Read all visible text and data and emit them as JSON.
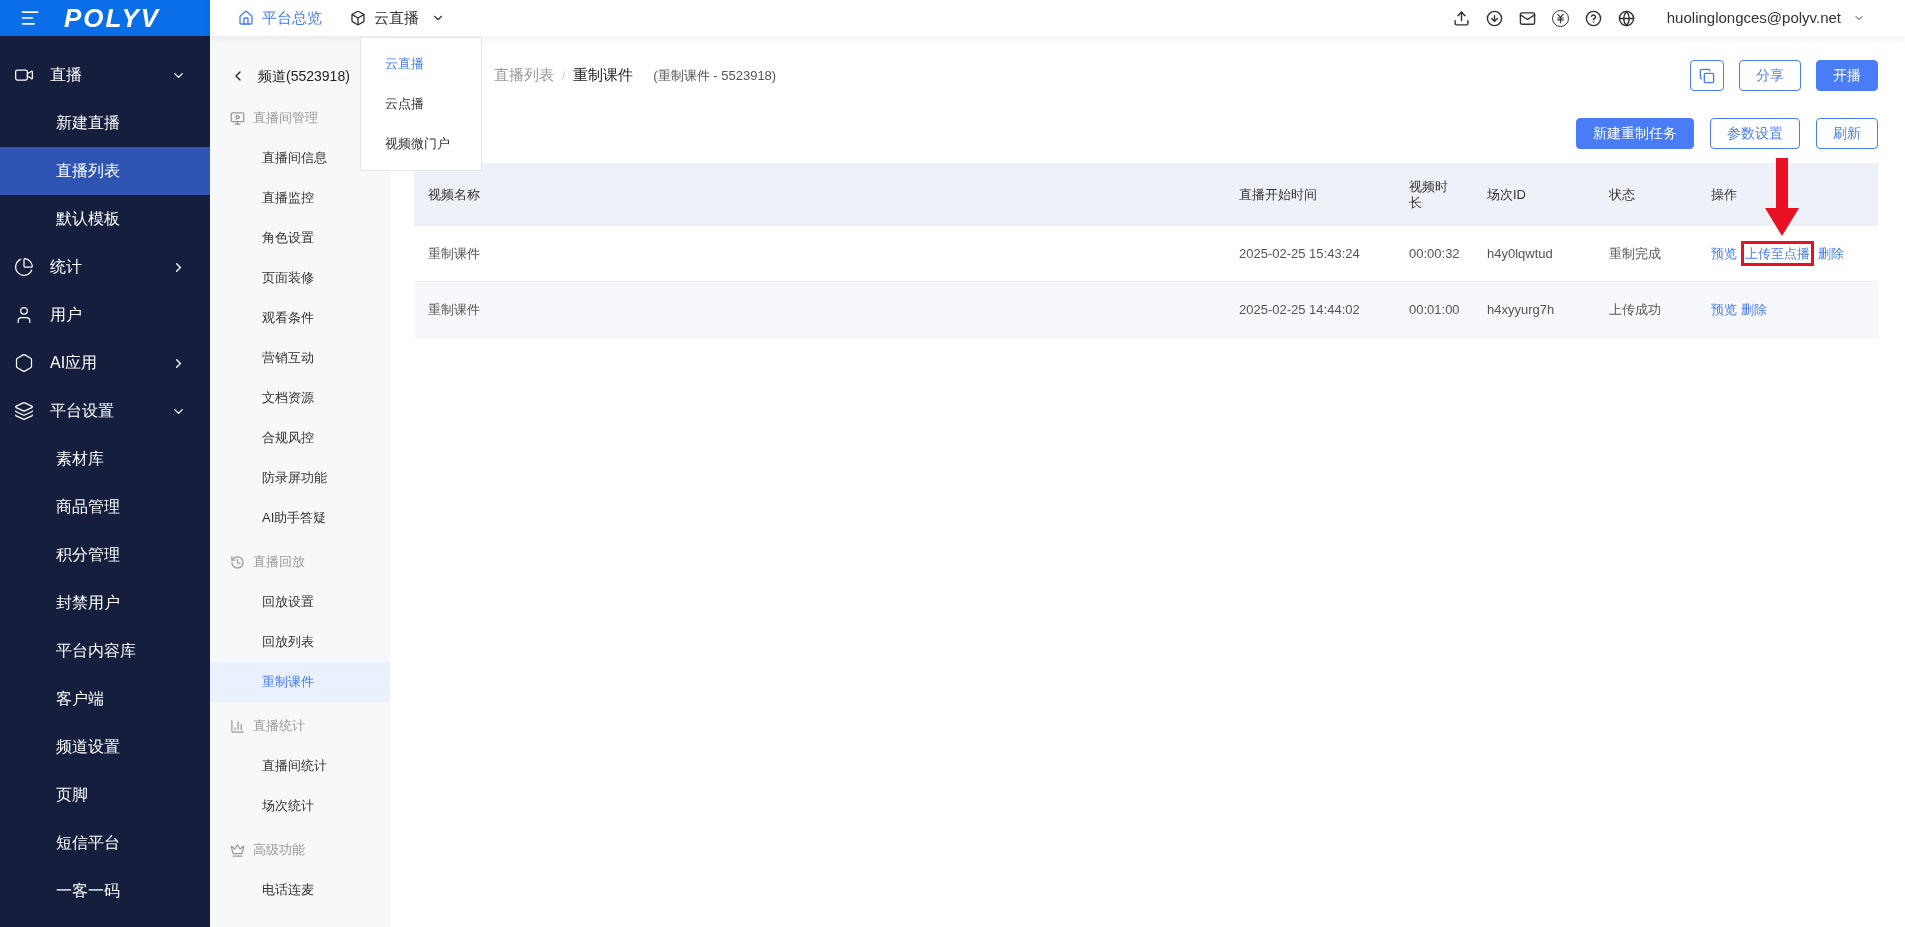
{
  "logo": "POLYV",
  "topnav": [
    {
      "label": "平台总览",
      "selected": true
    },
    {
      "label": "云直播",
      "selected": false
    }
  ],
  "dropdown": [
    {
      "label": "云直播",
      "selected": true
    },
    {
      "label": "云点播",
      "selected": false
    },
    {
      "label": "视频微门户",
      "selected": false
    }
  ],
  "user": "huolinglongces@polyv.net",
  "sidebar": [
    {
      "label": "直播",
      "expanded": true,
      "children": [
        {
          "label": "新建直播",
          "selected": false
        },
        {
          "label": "直播列表",
          "selected": true
        },
        {
          "label": "默认模板",
          "selected": false
        }
      ]
    },
    {
      "label": "统计",
      "expanded": false
    },
    {
      "label": "用户"
    },
    {
      "label": "AI应用",
      "expanded": false
    },
    {
      "label": "平台设置",
      "expanded": true,
      "children": [
        {
          "label": "素材库",
          "selected": false
        },
        {
          "label": "商品管理",
          "selected": false
        },
        {
          "label": "积分管理",
          "selected": false
        },
        {
          "label": "封禁用户",
          "selected": false
        },
        {
          "label": "平台内容库",
          "selected": false
        },
        {
          "label": "客户端",
          "selected": false
        },
        {
          "label": "频道设置",
          "selected": false
        },
        {
          "label": "页脚",
          "selected": false
        },
        {
          "label": "短信平台",
          "selected": false
        },
        {
          "label": "一客一码",
          "selected": false
        }
      ]
    }
  ],
  "subnav": {
    "back": "频道(5523918)",
    "groups": [
      {
        "title": "直播间管理",
        "items": [
          {
            "label": "直播间信息",
            "selected": false
          },
          {
            "label": "直播监控",
            "selected": false
          },
          {
            "label": "角色设置",
            "selected": false
          },
          {
            "label": "页面装修",
            "selected": false
          },
          {
            "label": "观看条件",
            "selected": false
          },
          {
            "label": "营销互动",
            "selected": false
          },
          {
            "label": "文档资源",
            "selected": false
          },
          {
            "label": "合规风控",
            "selected": false
          },
          {
            "label": "防录屏功能",
            "selected": false
          },
          {
            "label": "AI助手答疑",
            "selected": false
          }
        ]
      },
      {
        "title": "直播回放",
        "items": [
          {
            "label": "回放设置",
            "selected": false
          },
          {
            "label": "回放列表",
            "selected": false
          },
          {
            "label": "重制课件",
            "selected": true
          }
        ]
      },
      {
        "title": "直播统计",
        "items": [
          {
            "label": "直播间统计",
            "selected": false
          },
          {
            "label": "场次统计",
            "selected": false
          }
        ]
      },
      {
        "title": "高级功能",
        "items": [
          {
            "label": "电话连麦",
            "selected": false
          }
        ]
      }
    ]
  },
  "breadcrumb": [
    "直播列表",
    "重制课件"
  ],
  "breadcrumb_separator": "/",
  "subtitle": "(重制课件 - 5523918)",
  "header_buttons": [
    {
      "kind": "icon"
    },
    {
      "kind": "outline",
      "label": "分享"
    },
    {
      "kind": "primary",
      "label": "开播"
    }
  ],
  "toolbar": [
    {
      "kind": "primary",
      "label": "新建重制任务"
    },
    {
      "kind": "outline",
      "label": "参数设置"
    },
    {
      "kind": "outline",
      "label": "刷新"
    }
  ],
  "table": {
    "columns": [
      "视频名称",
      "直播开始时间",
      "视频时长",
      "场次ID",
      "状态",
      "操作"
    ],
    "rows": [
      {
        "cells": [
          "重制课件",
          "2025-02-25 15:43:24",
          "00:00:32",
          "h4y0lqwtud",
          "重制完成"
        ],
        "actions": [
          {
            "label": "预览",
            "highlighted": false
          },
          {
            "label": "上传至点播",
            "highlighted": true
          },
          {
            "label": "删除",
            "highlighted": false
          }
        ]
      },
      {
        "cells": [
          "重制课件",
          "2025-02-25 14:44:02",
          "00:01:00",
          "h4xyyurg7h",
          "上传成功"
        ],
        "actions": [
          {
            "label": "预览",
            "highlighted": false
          },
          {
            "label": "删除",
            "highlighted": false
          }
        ]
      }
    ]
  }
}
